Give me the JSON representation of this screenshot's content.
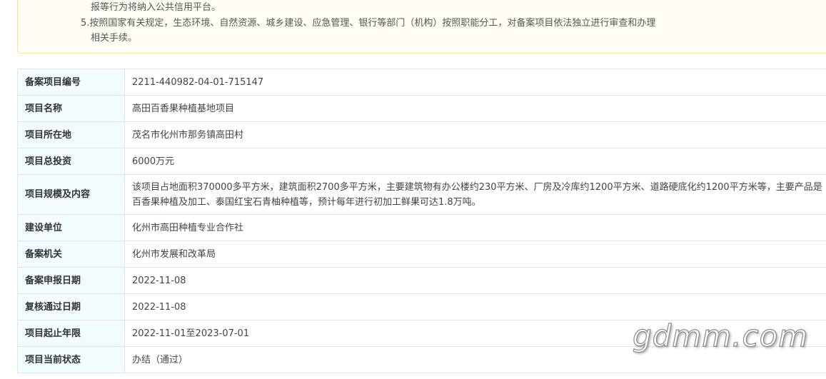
{
  "notice": {
    "line1": "报等行为将纳入公共信用平台。",
    "line2": "5.按照国家有关规定，生态环境、自然资源、城乡建设、应急管理、银行等部门（机构）按照职能分工，对备案项目依法独立进行审查和办理",
    "line3": "相关手续。"
  },
  "rows": [
    {
      "label": "备案项目编号",
      "value": "2211-440982-04-01-715147"
    },
    {
      "label": "项目名称",
      "value": "高田百香果种植基地项目"
    },
    {
      "label": "项目所在地",
      "value": "茂名市化州市那务镇高田村"
    },
    {
      "label": "项目总投资",
      "value": "6000万元"
    },
    {
      "label": "项目规模及内容",
      "value": "该项目占地面积370000多平方米，建筑面积2700多平方米，主要建筑物有办公楼约230平方米、厂房及冷库约1200平方米、道路硬底化约1200平方米等，主要产品是百香果种植及加工、泰国红宝石青柚种植等，预计每年进行初加工鲜果可达1.8万吨。"
    },
    {
      "label": "建设单位",
      "value": "化州市高田种植专业合作社"
    },
    {
      "label": "备案机关",
      "value": "化州市发展和改革局"
    },
    {
      "label": "备案申报日期",
      "value": "2022-11-08"
    },
    {
      "label": "复核通过日期",
      "value": "2022-11-08"
    },
    {
      "label": "项目起止年限",
      "value": "2022-11-01至2023-07-01"
    },
    {
      "label": "项目当前状态",
      "value": "办结（通过）"
    }
  ],
  "watermark": "gdmm.com"
}
